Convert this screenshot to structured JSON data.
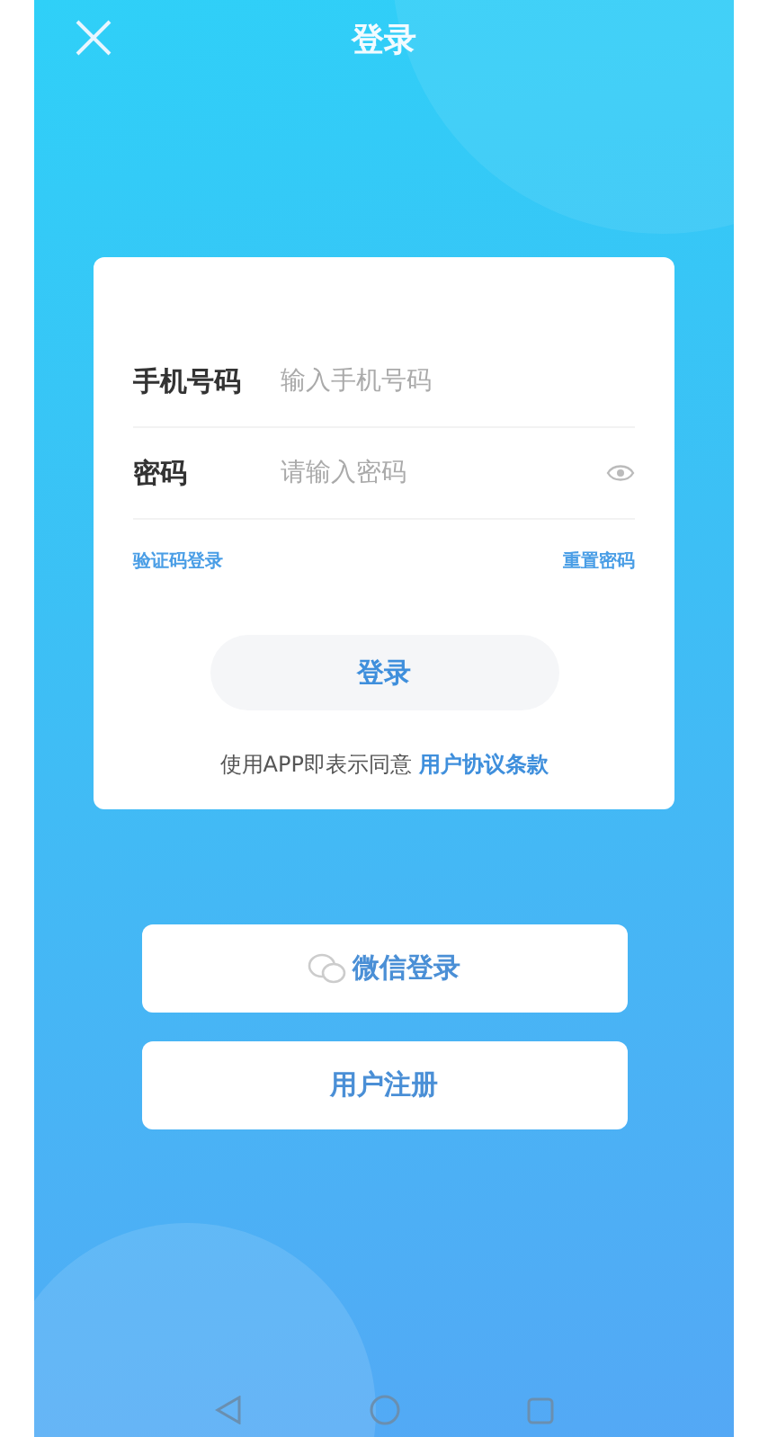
{
  "header": {
    "title": "登录"
  },
  "form": {
    "fields": [
      {
        "kind": "text",
        "label": "手机号码",
        "placeholder": "输入手机号码"
      },
      {
        "kind": "password",
        "label": "密码",
        "placeholder": "请输入密码"
      }
    ],
    "links": [
      "验证码登录",
      "重置密码"
    ],
    "submit": "登录",
    "agreement": {
      "text": "使用APP即表示同意",
      "link": "用户协议条款"
    }
  },
  "buttons": [
    {
      "kind": "wechat",
      "label": "微信登录"
    },
    {
      "kind": "plain",
      "label": "用户注册"
    }
  ]
}
